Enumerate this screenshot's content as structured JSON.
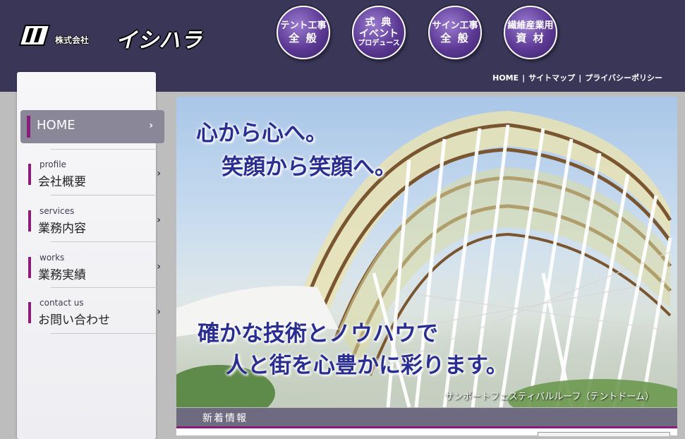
{
  "header": {
    "logo_sub": "株式会社",
    "logo_main": "イシハラ",
    "circle_buttons": [
      {
        "line1": "テント工事",
        "line2": "全 般",
        "line3": ""
      },
      {
        "line1": "式 典",
        "line2": "イベント",
        "line3": "プロデュース"
      },
      {
        "line1": "サイン工事",
        "line2": "全 般",
        "line3": ""
      },
      {
        "line1": "繊維産業用",
        "line2": "資 材",
        "line3": ""
      }
    ],
    "top_links": [
      "HOME",
      "サイトマップ",
      "プライバシーポリシー"
    ],
    "separator": "|"
  },
  "sidebar": {
    "home_label": "HOME",
    "chevron": "›",
    "items": [
      {
        "en": "profile",
        "jp": "会社概要"
      },
      {
        "en": "services",
        "jp": "業務内容"
      },
      {
        "en": "works",
        "jp": "業務実績"
      },
      {
        "en": "contact us",
        "jp": "お問い合わせ"
      }
    ]
  },
  "main": {
    "headline1": "心から心へ。",
    "headline2": "笑顔から笑顔へ。",
    "headline3": "確かな技術とノウハウで",
    "headline4": "人と街を心豊かに彩ります。",
    "caption": "サンポートフェスティバルルーフ（テントドーム）",
    "news_title": "新着情報"
  },
  "colors": {
    "header_bg": "#3a3658",
    "accent": "#8c1c79",
    "headline": "#2a2e90"
  }
}
